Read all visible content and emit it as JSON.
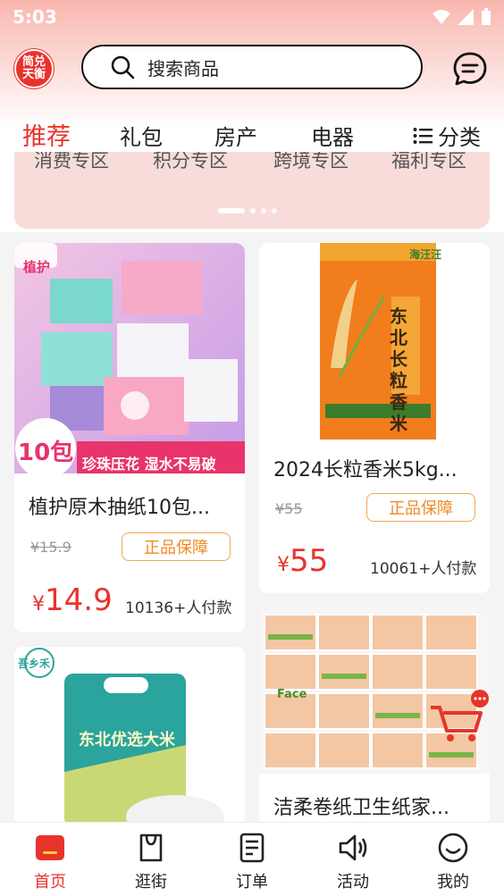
{
  "status": {
    "time": "5:03"
  },
  "header": {
    "logo_text": "简兑天衡",
    "search_placeholder": "搜索商品"
  },
  "tabs": [
    {
      "label": "推荐",
      "active": true
    },
    {
      "label": "礼包"
    },
    {
      "label": "房产"
    },
    {
      "label": "电器"
    },
    {
      "label": "分类"
    }
  ],
  "banner": {
    "items": [
      "消费专区",
      "积分专区",
      "跨境专区",
      "福利专区"
    ]
  },
  "products": [
    {
      "title": "植护原木抽纸10包...",
      "img_tag": "植护",
      "img_count": "10包",
      "img_slogan": "珍珠压花 湿水不易破",
      "original_price": "¥15.9",
      "badge": "正品保障",
      "currency": "¥",
      "price": "14.9",
      "sold": "10136+人付款"
    },
    {
      "title": "2024长粒香米5kg...",
      "img_brand": "海汪汪",
      "img_product": "东北长粒香米",
      "original_price": "¥55",
      "badge": "正品保障",
      "currency": "¥",
      "price": "55",
      "sold": "10061+人付款"
    },
    {
      "title": "东北优选大米",
      "img_brand": "吾乡禾",
      "img_product": "东北优选大米"
    },
    {
      "title": "洁柔卷纸卫生纸家...",
      "img_brand": "Face"
    }
  ],
  "colors": {
    "accent": "#e8332b",
    "badge": "#f08a24"
  },
  "bottom_nav": [
    {
      "label": "首页",
      "icon": "home-icon",
      "active": true
    },
    {
      "label": "逛街",
      "icon": "shopping-bag-icon"
    },
    {
      "label": "订单",
      "icon": "order-icon"
    },
    {
      "label": "活动",
      "icon": "speaker-icon"
    },
    {
      "label": "我的",
      "icon": "smile-icon"
    }
  ]
}
